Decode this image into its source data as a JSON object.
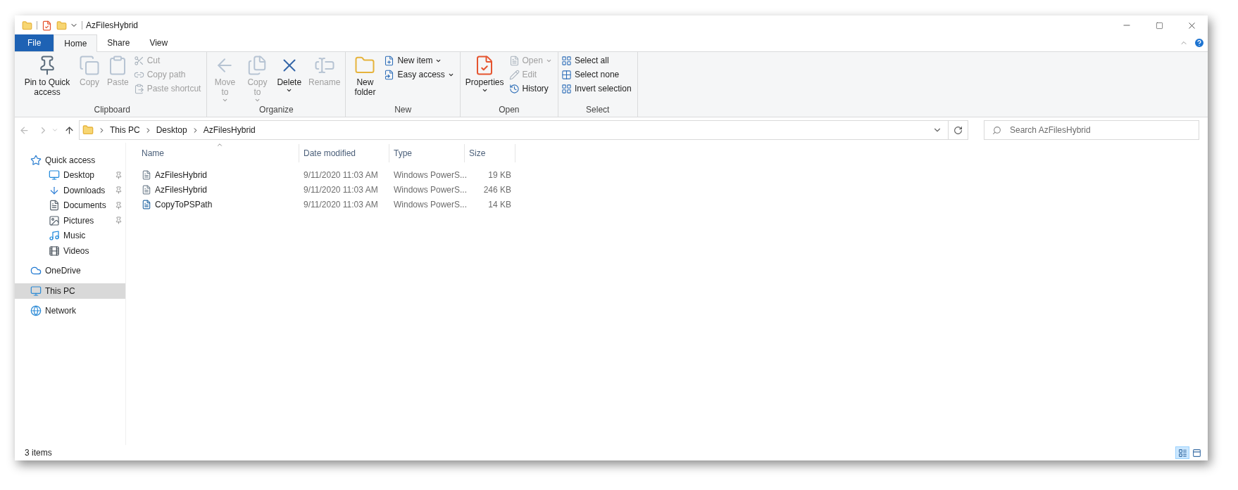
{
  "window": {
    "title": "AzFilesHybrid"
  },
  "ribbon_tabs": [
    {
      "label": "File",
      "kind": "file",
      "selected": false
    },
    {
      "label": "Home",
      "kind": "tab",
      "selected": true
    },
    {
      "label": "Share",
      "kind": "tab",
      "selected": false
    },
    {
      "label": "View",
      "kind": "tab",
      "selected": false
    }
  ],
  "ribbon_groups": [
    {
      "label": "Clipboard",
      "commands": [
        {
          "label": "Pin to Quick access",
          "kind": "large",
          "disabled": false,
          "dropdown": false
        },
        {
          "label": "Copy",
          "kind": "large",
          "disabled": true,
          "dropdown": false
        },
        {
          "label": "Paste",
          "kind": "large",
          "disabled": true,
          "dropdown": false
        },
        {
          "label": "Cut",
          "kind": "small",
          "disabled": true,
          "dropdown": false
        },
        {
          "label": "Copy path",
          "kind": "small",
          "disabled": true,
          "dropdown": false
        },
        {
          "label": "Paste shortcut",
          "kind": "small",
          "disabled": true,
          "dropdown": false
        }
      ]
    },
    {
      "label": "Organize",
      "commands": [
        {
          "label": "Move to",
          "kind": "large",
          "disabled": true,
          "dropdown": true
        },
        {
          "label": "Copy to",
          "kind": "large",
          "disabled": true,
          "dropdown": true
        },
        {
          "label": "Delete",
          "kind": "large",
          "disabled": false,
          "dropdown": true
        },
        {
          "label": "Rename",
          "kind": "large",
          "disabled": true,
          "dropdown": false
        }
      ]
    },
    {
      "label": "New",
      "commands": [
        {
          "label": "New folder",
          "kind": "large",
          "disabled": false,
          "dropdown": false
        },
        {
          "label": "New item",
          "kind": "small",
          "disabled": false,
          "dropdown": true
        },
        {
          "label": "Easy access",
          "kind": "small",
          "disabled": false,
          "dropdown": true
        }
      ]
    },
    {
      "label": "Open",
      "commands": [
        {
          "label": "Properties",
          "kind": "large",
          "disabled": false,
          "dropdown": true
        },
        {
          "label": "Open",
          "kind": "small",
          "disabled": true,
          "dropdown": true
        },
        {
          "label": "Edit",
          "kind": "small",
          "disabled": true,
          "dropdown": false
        },
        {
          "label": "History",
          "kind": "small",
          "disabled": false,
          "dropdown": false
        }
      ]
    },
    {
      "label": "Select",
      "commands": [
        {
          "label": "Select all",
          "kind": "small",
          "disabled": false,
          "dropdown": false
        },
        {
          "label": "Select none",
          "kind": "small",
          "disabled": false,
          "dropdown": false
        },
        {
          "label": "Invert selection",
          "kind": "small",
          "disabled": false,
          "dropdown": false
        }
      ]
    }
  ],
  "address_bar": {
    "path": [
      "This PC",
      "Desktop",
      "AzFilesHybrid"
    ]
  },
  "search": {
    "placeholder": "Search AzFilesHybrid"
  },
  "sidebar": {
    "items": [
      {
        "label": "Quick access",
        "selected": false,
        "children": [
          {
            "label": "Desktop",
            "selected": false,
            "pinned": true
          },
          {
            "label": "Downloads",
            "selected": false,
            "pinned": true
          },
          {
            "label": "Documents",
            "selected": false,
            "pinned": true
          },
          {
            "label": "Pictures",
            "selected": false,
            "pinned": true
          },
          {
            "label": "Music",
            "selected": false,
            "pinned": false
          },
          {
            "label": "Videos",
            "selected": false,
            "pinned": false
          }
        ]
      },
      {
        "label": "OneDrive",
        "selected": false
      },
      {
        "label": "This PC",
        "selected": true
      },
      {
        "label": "Network",
        "selected": false
      }
    ]
  },
  "file_list": {
    "columns": [
      "Name",
      "Date modified",
      "Type",
      "Size"
    ],
    "rows": [
      {
        "name": "AzFilesHybrid",
        "date_modified": "9/11/2020 11:03 AM",
        "type": "Windows PowerS...",
        "size": "19 KB",
        "kind": "module"
      },
      {
        "name": "AzFilesHybrid",
        "date_modified": "9/11/2020 11:03 AM",
        "type": "Windows PowerS...",
        "size": "246 KB",
        "kind": "module"
      },
      {
        "name": "CopyToPSPath",
        "date_modified": "9/11/2020 11:03 AM",
        "type": "Windows PowerS...",
        "size": "14 KB",
        "kind": "script"
      }
    ]
  },
  "status_bar": {
    "text": "3 items",
    "view_buttons": [
      {
        "kind": "details",
        "selected": true
      },
      {
        "kind": "large_icons",
        "selected": false
      }
    ]
  }
}
